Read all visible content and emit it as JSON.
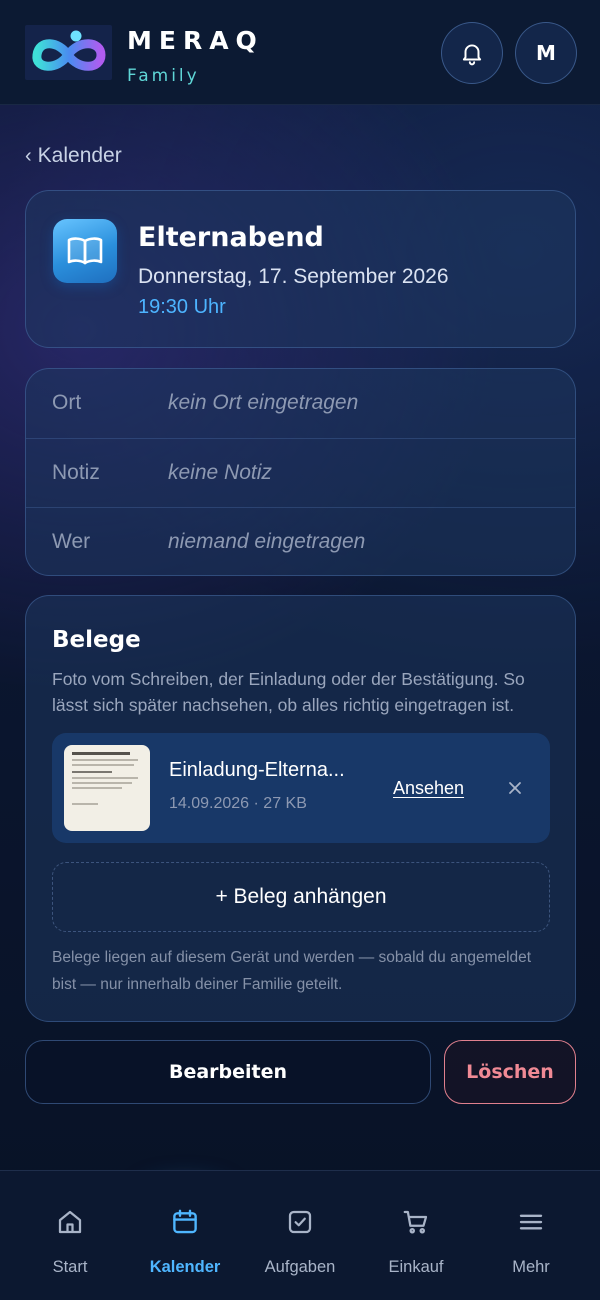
{
  "header": {
    "brand_name": "MERAQ",
    "brand_sub": "Family",
    "avatar_initial": "M",
    "icons": {
      "logo": "infinity-logo",
      "bell": "bell-icon"
    }
  },
  "back_link": {
    "label": "Kalender"
  },
  "event": {
    "title": "Elternabend",
    "date": "Donnerstag, 17. September 2026",
    "time": "19:30 Uhr",
    "icon": "book-icon"
  },
  "details": [
    {
      "label": "Ort",
      "value": "kein Ort eingetragen"
    },
    {
      "label": "Notiz",
      "value": "keine Notiz"
    },
    {
      "label": "Wer",
      "value": "niemand eingetragen"
    }
  ],
  "receipts": {
    "title": "Belege",
    "description": "Foto vom Schreiben, der Einladung oder der Bestätigung. So lässt sich später nachsehen, ob alles richtig eingetragen ist.",
    "attachment": {
      "name": "Einladung-Elterna...",
      "meta": "14.09.2026 · 27 KB",
      "view_label": "Ansehen"
    },
    "attach_button": "+ Beleg anhängen",
    "note": "Belege liegen auf diesem Gerät und werden — sobald du angemeldet bist — nur innerhalb deiner Familie geteilt."
  },
  "actions": {
    "edit": "Bearbeiten",
    "delete": "Löschen"
  },
  "nav": [
    {
      "label": "Start",
      "icon": "home-icon",
      "active": false
    },
    {
      "label": "Kalender",
      "icon": "calendar-icon",
      "active": true
    },
    {
      "label": "Aufgaben",
      "icon": "checkbox-icon",
      "active": false
    },
    {
      "label": "Einkauf",
      "icon": "cart-icon",
      "active": false
    },
    {
      "label": "Mehr",
      "icon": "menu-icon",
      "active": false
    }
  ],
  "colors": {
    "accent": "#4fb6ff",
    "teal": "#5fd6d6",
    "danger": "#f08a95",
    "background": "#0b1630"
  }
}
